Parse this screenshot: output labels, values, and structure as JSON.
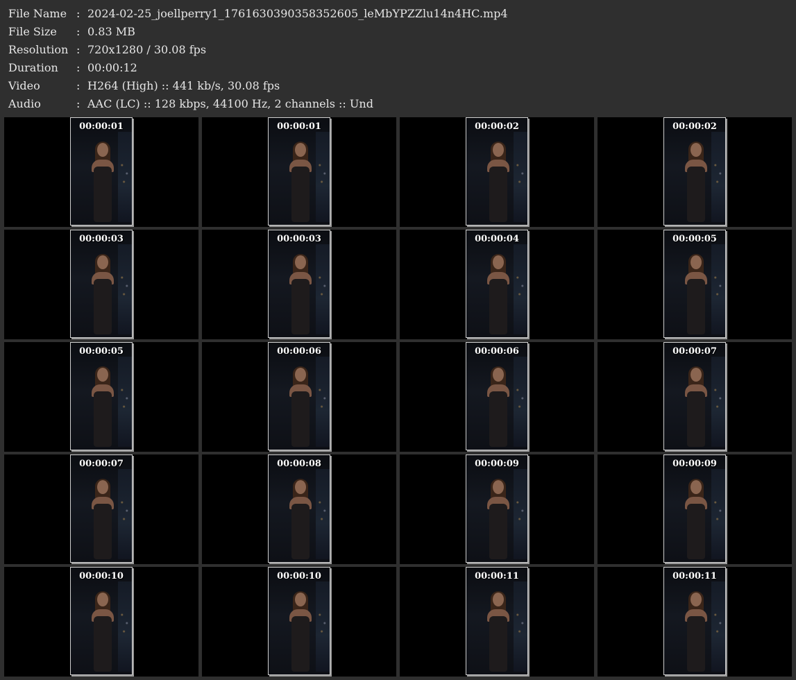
{
  "file_info": [
    {
      "key": "File Name",
      "sep": ":",
      "value": "2024-02-25_joellperry1_1761630390358352605_leMbYPZZlu14n4HC.mp4"
    },
    {
      "key": "File Size",
      "sep": ":",
      "value": "0.83 MB"
    },
    {
      "key": "Resolution",
      "sep": ":",
      "value": "720x1280 / 30.08 fps"
    },
    {
      "key": "Duration",
      "sep": ":",
      "value": "00:00:12"
    },
    {
      "key": "Video",
      "sep": ":",
      "value": "H264 (High) :: 441 kb/s, 30.08 fps"
    },
    {
      "key": "Audio",
      "sep": ":",
      "value": "AAC (LC) :: 128 kbps, 44100 Hz, 2 channels :: Und"
    }
  ],
  "thumbnails": [
    {
      "time": "00:00:01"
    },
    {
      "time": "00:00:01"
    },
    {
      "time": "00:00:02"
    },
    {
      "time": "00:00:02"
    },
    {
      "time": "00:00:03"
    },
    {
      "time": "00:00:03"
    },
    {
      "time": "00:00:04"
    },
    {
      "time": "00:00:05"
    },
    {
      "time": "00:00:05"
    },
    {
      "time": "00:00:06"
    },
    {
      "time": "00:00:06"
    },
    {
      "time": "00:00:07"
    },
    {
      "time": "00:00:07"
    },
    {
      "time": "00:00:08"
    },
    {
      "time": "00:00:09"
    },
    {
      "time": "00:00:09"
    },
    {
      "time": "00:00:10"
    },
    {
      "time": "00:00:10"
    },
    {
      "time": "00:00:11"
    },
    {
      "time": "00:00:11"
    }
  ],
  "colors": {
    "background": "#2f2f2f",
    "tile": "#000000",
    "text": "#e6e6e6",
    "frame_border": "#cfcfcf"
  }
}
